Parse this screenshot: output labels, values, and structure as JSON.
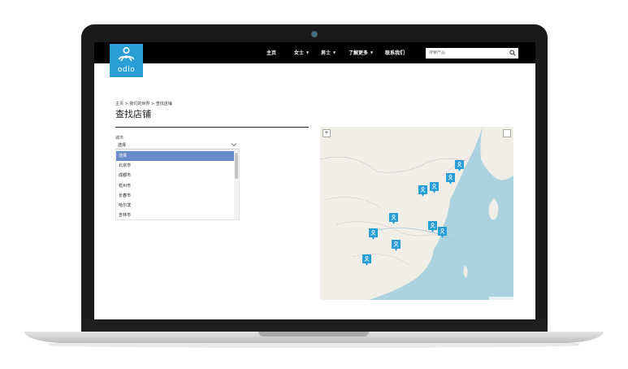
{
  "colors": {
    "brand": "#2a9fd6",
    "header_bg": "#000000",
    "selected": "#6a8bc9",
    "water": "#aad3df",
    "land": "#f1eee8"
  },
  "logo": {
    "text": "odlo",
    "icon": "odlo-logo-icon"
  },
  "nav": {
    "items": [
      {
        "label": "主页",
        "has_caret": false
      },
      {
        "label": "女士",
        "has_caret": true
      },
      {
        "label": "男士",
        "has_caret": true
      },
      {
        "label": "了解更多",
        "has_caret": true
      },
      {
        "label": "联系我们",
        "has_caret": false
      }
    ],
    "caret": "▼"
  },
  "search": {
    "placeholder": "搜索产品",
    "icon": "search-icon"
  },
  "breadcrumb": "主页 > 我们的世界 > 查找店铺",
  "page_title": "查找店铺",
  "city_filter": {
    "label": "城市",
    "selected": "选择",
    "options": [
      "选择",
      "北京市",
      "成都市",
      "杭州市",
      "长春市",
      "哈尔滨",
      "吉林市"
    ]
  },
  "map": {
    "zoom_control": "+",
    "marker_icon": "store-marker-icon"
  }
}
